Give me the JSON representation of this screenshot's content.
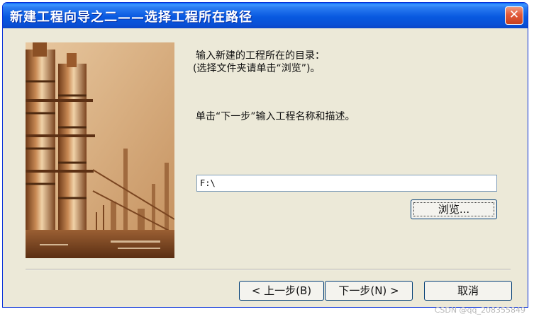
{
  "window": {
    "title": "新建工程向导之二——选择工程所在路径",
    "close_glyph": "✕"
  },
  "content": {
    "line1": "输入新建的工程所在的目录：",
    "line2": "(选择文件夹请单击“浏览”)。",
    "line3": "单击“下一步”输入工程名称和描述。"
  },
  "path_input": {
    "value": "F:\\"
  },
  "buttons": {
    "browse": "浏览...",
    "back": "< 上一步(B)",
    "next": "下一步(N) >",
    "cancel": "取消"
  },
  "watermark": "CSDN @qq_208355849",
  "illustration": {
    "subject": "industrial refinery towers photograph",
    "tint_color": "#a7683a",
    "highlight_color": "#e9c9a3"
  },
  "colors": {
    "titlebar": "#0a5ae0",
    "dialog_bg": "#ece9d8",
    "close_button": "#e2593a"
  }
}
